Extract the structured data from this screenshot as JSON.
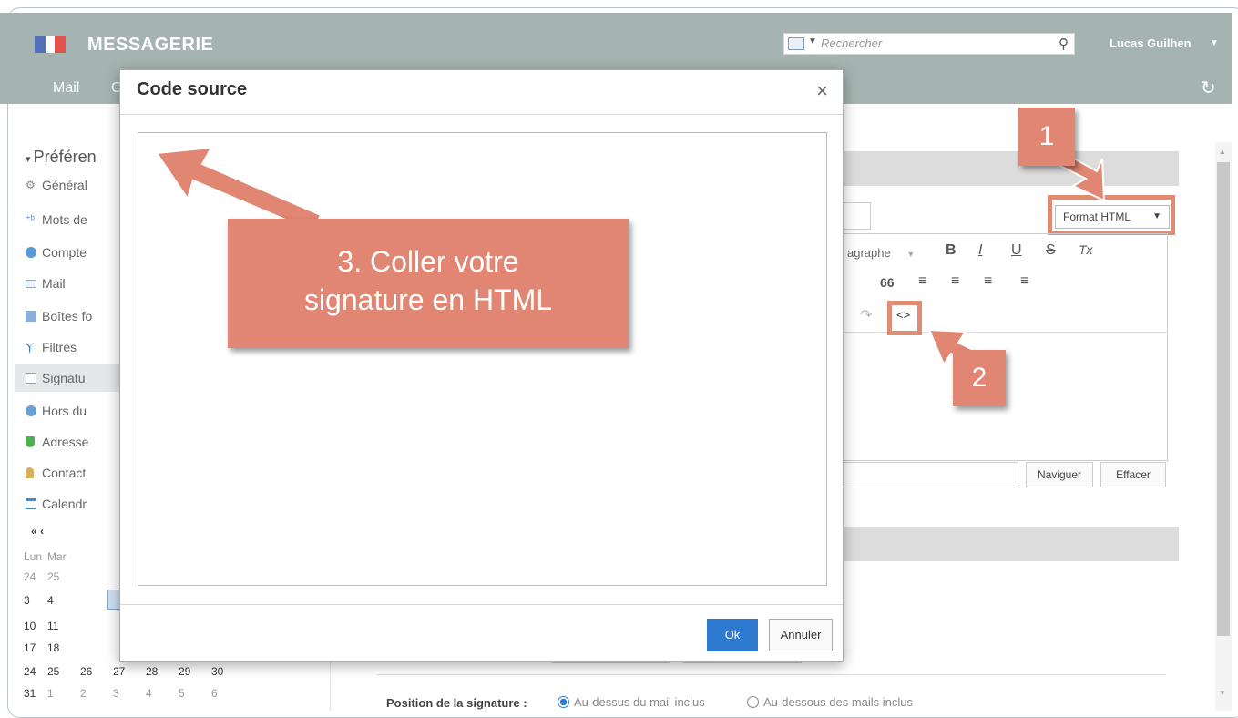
{
  "header": {
    "app_title": "MESSAGERIE",
    "search_placeholder": "Rechercher",
    "user_name": "Lucas Guilhen",
    "nav_mail": "Mail",
    "nav_partial": "C"
  },
  "sidebar": {
    "section_title": "Préféren",
    "items": [
      {
        "label": "Général",
        "icon": "gear-icon"
      },
      {
        "label": "Mots de",
        "icon": "dictionary-icon"
      },
      {
        "label": "Compte",
        "icon": "account-icon"
      },
      {
        "label": "Mail",
        "icon": "mail-icon"
      },
      {
        "label": "Boîtes fo",
        "icon": "mailboxes-icon"
      },
      {
        "label": "Filtres",
        "icon": "filter-icon"
      },
      {
        "label": "Signatu",
        "icon": "signature-icon"
      },
      {
        "label": "Hors du",
        "icon": "out-of-office-icon"
      },
      {
        "label": "Adresse",
        "icon": "shield-icon"
      },
      {
        "label": "Contact",
        "icon": "contacts-icon"
      },
      {
        "label": "Calendr",
        "icon": "calendar-icon"
      }
    ],
    "calendar": {
      "nav": "« ‹",
      "weekday_headers": [
        "Lun",
        "Mar"
      ],
      "rows": [
        [
          "24",
          "25"
        ],
        [
          "3",
          "4"
        ],
        [
          "10",
          "11"
        ],
        [
          "17",
          "18"
        ],
        [
          "24",
          "25",
          "26",
          "27",
          "28",
          "29",
          "30"
        ],
        [
          "31",
          "1",
          "2",
          "3",
          "4",
          "5",
          "6"
        ]
      ]
    }
  },
  "modal": {
    "title": "Code source",
    "close": "×",
    "textarea_value": "",
    "ok_label": "Ok",
    "cancel_label": "Annuler"
  },
  "editor": {
    "format_label": "Format HTML",
    "paragraph_label": "agraphe",
    "bold": "B",
    "italic": "I",
    "underline": "U",
    "strike": "S",
    "clear_format": "Tx",
    "quote": "66",
    "redo": "↷",
    "source_code": "<>",
    "browse_label": "Naviguer",
    "clear_label": "Effacer"
  },
  "signature_position": {
    "label": "Position de la signature :",
    "option_above": "Au-dessus du mail inclus",
    "option_below": "Au-dessous des mails inclus"
  },
  "annotations": {
    "step1": "1",
    "step2": "2",
    "step3_line1": "3. Coller votre",
    "step3_line2": "signature en HTML"
  },
  "colors": {
    "header_bg": "#a5b4b0",
    "callout": "#e08672",
    "primary_button": "#2e7ad1"
  }
}
